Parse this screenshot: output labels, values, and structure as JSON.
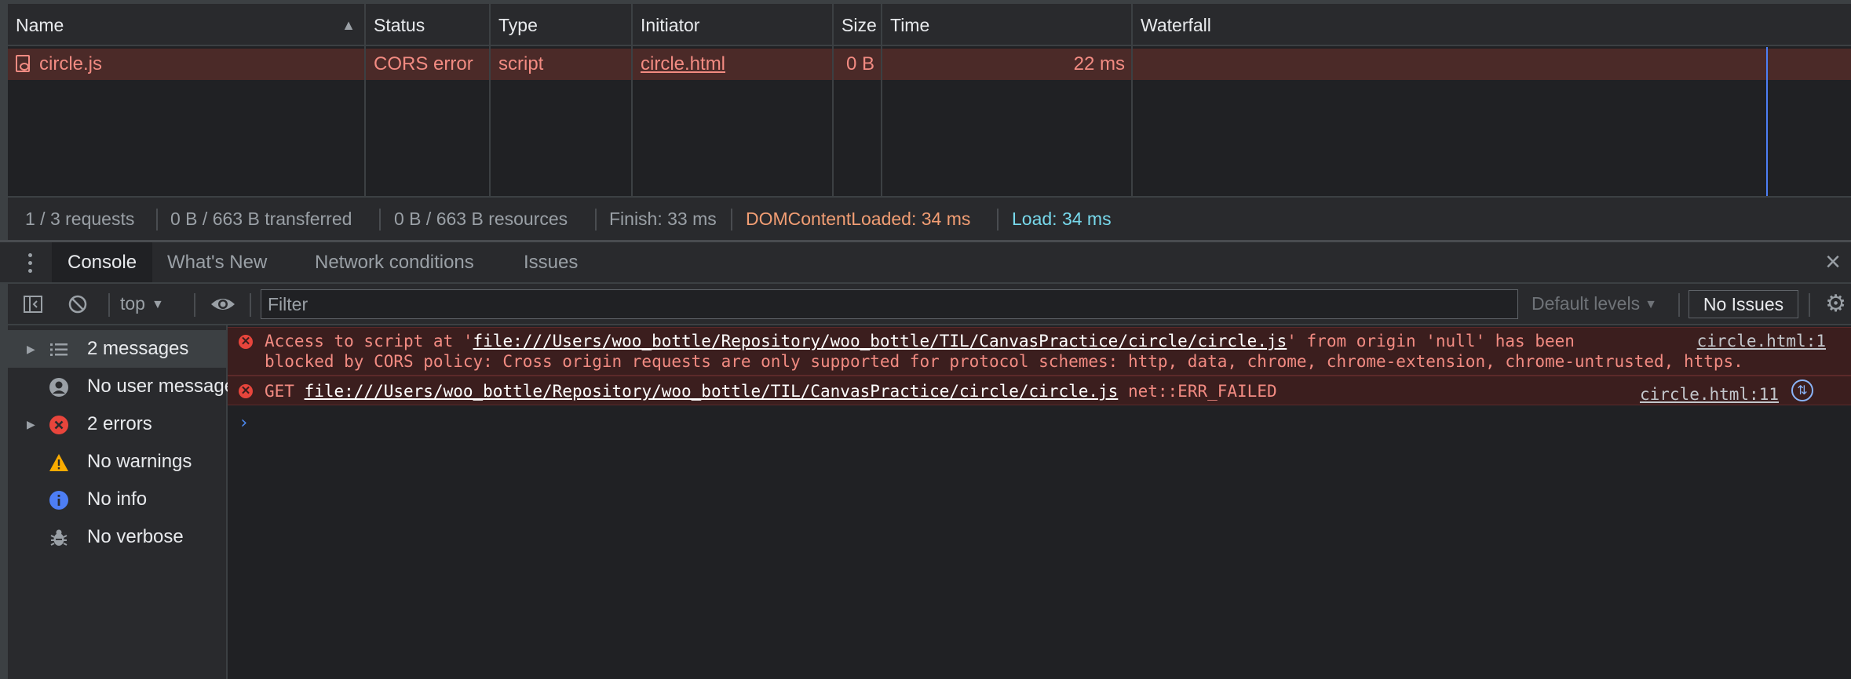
{
  "network": {
    "columns": [
      "Name",
      "Status",
      "Type",
      "Initiator",
      "Size",
      "Time",
      "Waterfall"
    ],
    "row": {
      "name": "circle.js",
      "status": "CORS error",
      "type": "script",
      "initiator": "circle.html",
      "size": "0 B",
      "time": "22 ms"
    }
  },
  "statusbar": {
    "requests": "1 / 3 requests",
    "transferred": "0 B / 663 B transferred",
    "resources": "0 B / 663 B resources",
    "finish": "Finish: 33 ms",
    "dom_loaded": "DOMContentLoaded: 34 ms",
    "load": "Load: 34 ms"
  },
  "drawer": {
    "tabs": [
      "Console",
      "What's New",
      "Network conditions",
      "Issues"
    ],
    "active_tab": "Console"
  },
  "toolbar": {
    "context": "top",
    "filter_placeholder": "Filter",
    "levels": "Default levels",
    "issues_button": "No Issues"
  },
  "sidebar": {
    "items": [
      {
        "label": "2 messages",
        "icon": "list-icon"
      },
      {
        "label": "No user messages",
        "icon": "user-icon"
      },
      {
        "label": "2 errors",
        "icon": "error-icon"
      },
      {
        "label": "No warnings",
        "icon": "warning-icon"
      },
      {
        "label": "No info",
        "icon": "info-icon"
      },
      {
        "label": "No verbose",
        "icon": "bug-icon"
      }
    ]
  },
  "console": {
    "messages": [
      {
        "prefix": "Access to script at '",
        "url": "file:///Users/woo_bottle/Repository/woo_bottle/TIL/CanvasPractice/circle/circle.js",
        "suffix": "' from origin 'null' has been",
        "line2": "blocked by CORS policy: Cross origin requests are only supported for protocol schemes: http, data, chrome, chrome-extension, chrome-untrusted, https.",
        "source": "circle.html:1"
      },
      {
        "prefix": "GET ",
        "url": "file:///Users/woo_bottle/Repository/woo_bottle/TIL/CanvasPractice/circle/circle.js",
        "suffix": " net::ERR_FAILED",
        "source": "circle.html:11"
      }
    ],
    "prompt": "›"
  },
  "colors": {
    "error_text": "#f28b82",
    "error_row_bg": "#4b2a28",
    "dom_loaded": "#f29e74",
    "load": "#78d9ec",
    "waterfall_line": "#4d7ef4"
  }
}
